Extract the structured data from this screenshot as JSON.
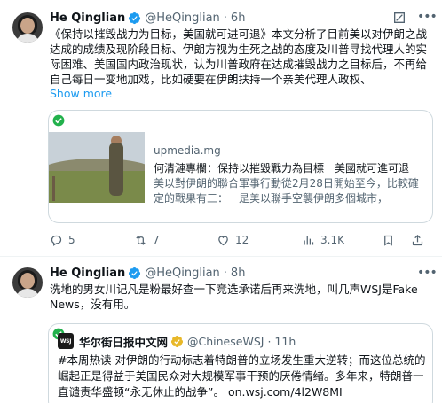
{
  "tweets": [
    {
      "author_name": "He Qinglian",
      "handle": "@HeQinglian",
      "time_separator": "·",
      "time": "6h",
      "text": "《保持以摧毁战力为目标，美国就可进可退》本文分析了目前美以对伊朗之战达成的成绩及现阶段目标、伊朗方视为生死之战的态度及川普寻找代理人的实际困难、美国国内政治现状，认为川普政府在达成摧毁战力之目标后，不再给自己每日一变地加戏，比如硬要在伊朗扶持一个亲美代理人政权、",
      "show_more": "Show more",
      "card": {
        "domain": "upmedia.mg",
        "title": "何清漣專欄：保持以摧毀戰力為目標　美國就可進可退",
        "description": "美以對伊朗的聯合軍事行動從2月28日開始至今，比較確定的戰果有三：一是美以聯手空襲伊朗多個城市，"
      },
      "actions": {
        "replies": "5",
        "retweets": "7",
        "likes": "12",
        "views": "3.1K"
      }
    },
    {
      "author_name": "He Qinglian",
      "handle": "@HeQinglian",
      "time_separator": "·",
      "time": "8h",
      "text": "洗地的男女川记凡是粉最好查一下竞选承诺后再来洗地，叫几声WSJ是Fake News，没有用。",
      "quote": {
        "logo_text": "WSJ",
        "author_name": "华尔街日报中文网",
        "handle": "@ChineseWSJ",
        "time_separator": "·",
        "time": "11h",
        "text": "#本周热读 对伊朗的行动标志着特朗普的立场发生重大逆转；而这位总统的崛起正是得益于美国民众对大规模军事干预的厌倦情绪。多年来，特朗普一直谴责华盛顿“永无休止的战争”。",
        "link": "on.wsj.com/4l2W8MI"
      }
    }
  ],
  "colors": {
    "accent": "#1d9bf0",
    "verified_gold": "#e8b829",
    "muted": "#536471",
    "border": "#cfd9de",
    "check_green": "#22b14c"
  }
}
